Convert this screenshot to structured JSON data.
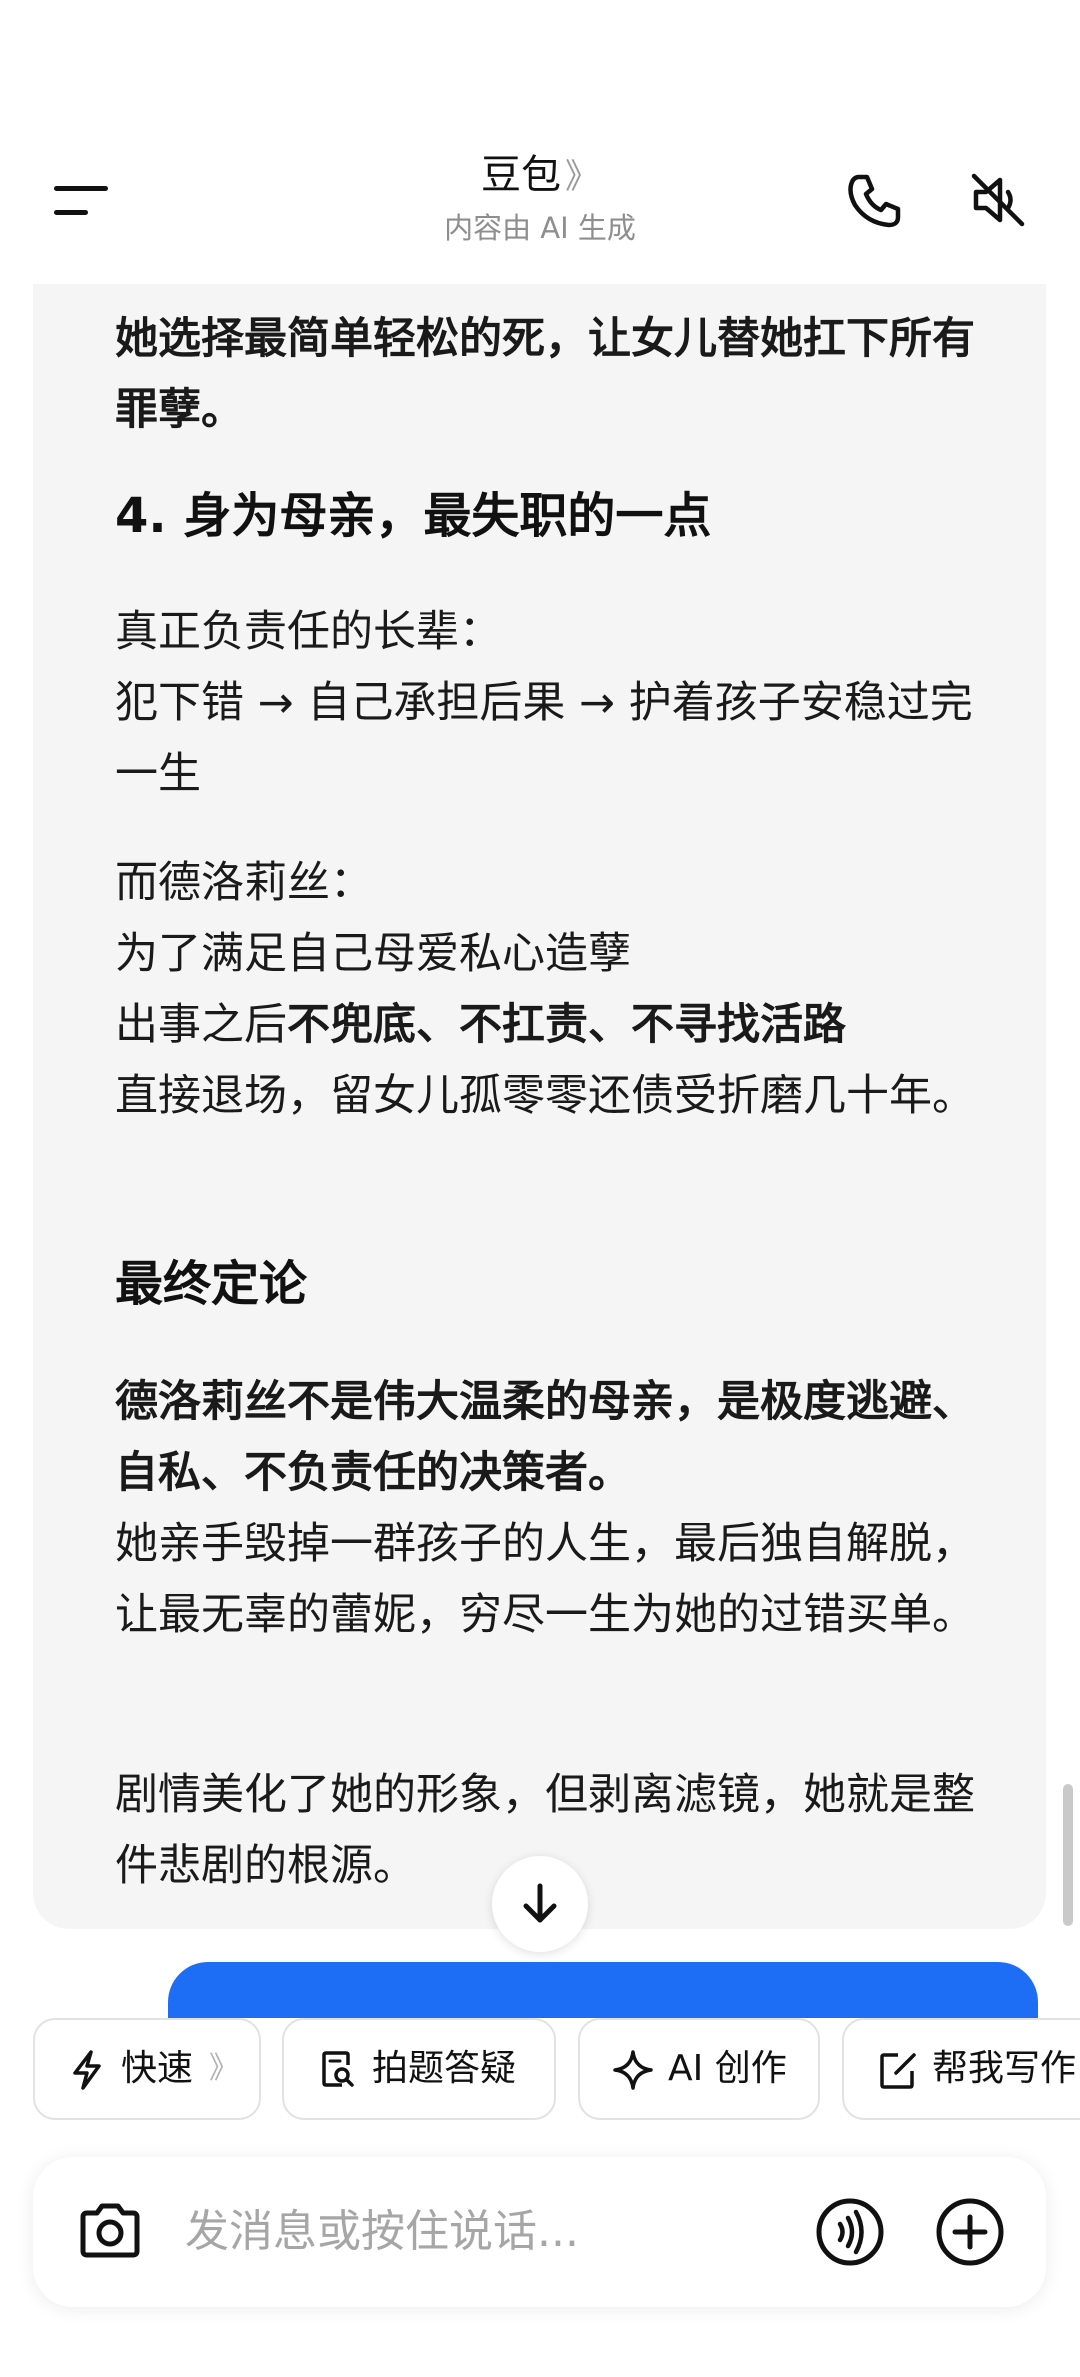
{
  "header": {
    "title": "豆包",
    "title_chevron": "》",
    "subtitle": "内容由 AI 生成"
  },
  "message": {
    "p1": "她选择最简单轻松的死，让女儿替她扛下所有罪孽。",
    "h4": "4. 身为母亲，最失职的一点",
    "p2_line1": "真正负责任的长辈：",
    "p2_line2": "犯下错 → 自己承担后果 → 护着孩子安稳过完一生",
    "p3_line1": "而德洛莉丝：",
    "p3_line2": "为了满足自己母爱私心造孽",
    "p3_line3_plain": "出事之后",
    "p3_line3_bold": "不兜底、不扛责、不寻找活路",
    "p3_line4": "直接退场，留女儿孤零零还债受折磨几十年。",
    "h_final": "最终定论",
    "p4_bold": "德洛莉丝不是伟大温柔的母亲，是极度逃避、自私、不负责任的决策者。",
    "p4_plain": "她亲手毁掉一群孩子的人生，最后独自解脱，让最无辜的蕾妮，穷尽一生为她的过错买单。",
    "p5": "剧情美化了她的形象，但剥离滤镜，她就是整件悲剧的根源。"
  },
  "quick_actions": [
    {
      "label": "快速",
      "icon": "lightning-icon",
      "chevron": "》"
    },
    {
      "label": "拍题答疑",
      "icon": "search-doc-icon"
    },
    {
      "label": "AI 创作",
      "icon": "sparkle-icon"
    },
    {
      "label": "帮我写作",
      "icon": "edit-icon"
    }
  ],
  "input": {
    "placeholder": "发消息或按住说话..."
  },
  "colors": {
    "accent_blue": "#1e6ef5",
    "card_bg": "#f5f5f5"
  }
}
